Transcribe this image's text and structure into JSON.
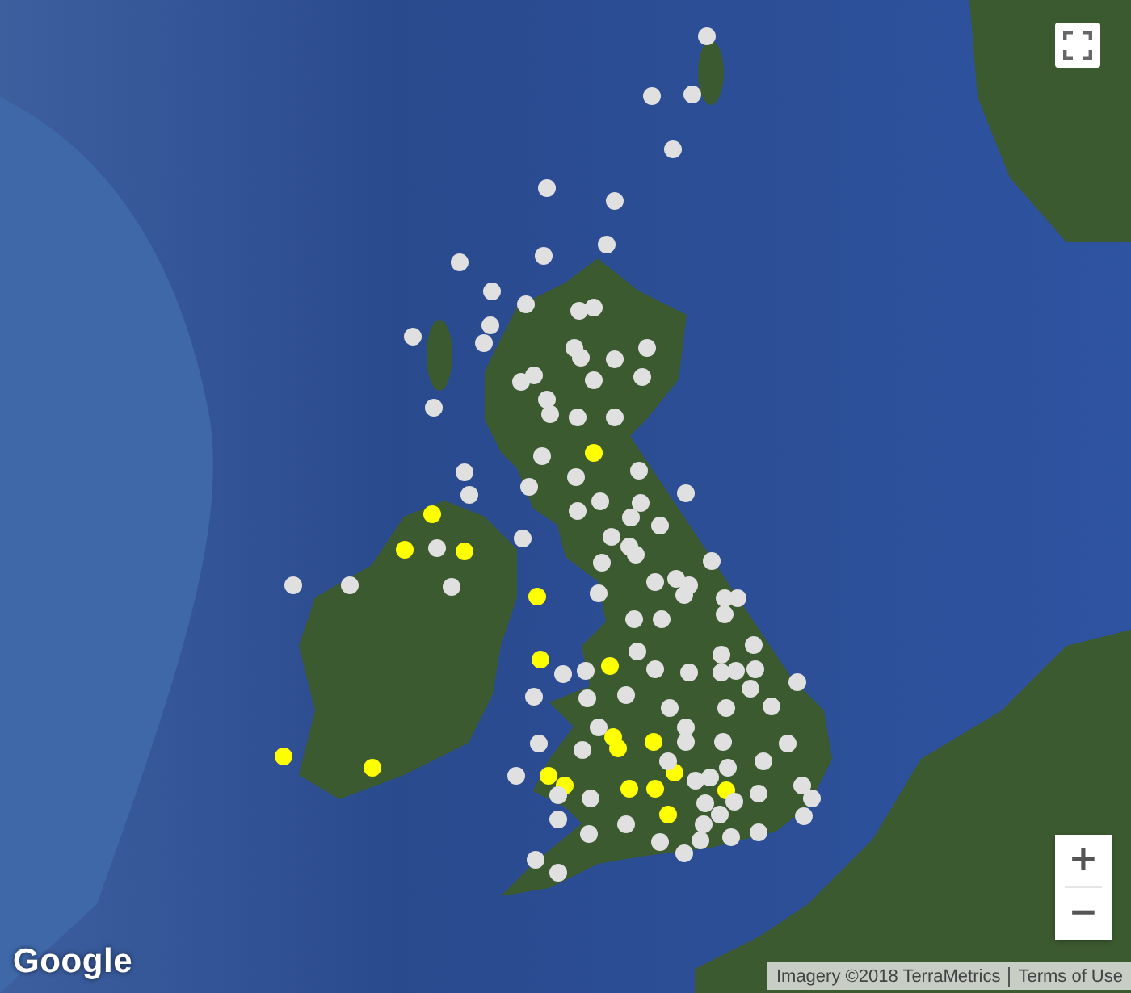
{
  "map": {
    "markers": [
      {
        "color": "#ffff00"
      },
      {
        "color": "#ffff00"
      },
      {
        "color": "#ffff00"
      },
      {
        "color": "#ffff00"
      },
      {
        "color": "#ffff00"
      },
      {
        "color": "#ffff00"
      },
      {
        "color": "#ffff00"
      },
      {
        "color": "#ffff00"
      },
      {
        "color": "#ffff00"
      },
      {
        "color": "#ffff00"
      },
      {
        "color": "#ffff00"
      },
      {
        "color": "#ffff00"
      },
      {
        "color": "#ffff00"
      },
      {
        "color": "#ffff00"
      },
      {
        "color": "#ffff00"
      },
      {
        "color": "#ffff00"
      },
      {
        "color": "#ffff00"
      },
      {
        "color": "#ffff00"
      },
      {
        "color": "#ffff00"
      },
      {
        "color": "#e0e0e0"
      },
      {
        "color": "#e0e0e0"
      },
      {
        "color": "#e0e0e0"
      },
      {
        "color": "#e0e0e0"
      },
      {
        "color": "#e0e0e0"
      },
      {
        "color": "#e0e0e0"
      },
      {
        "color": "#e0e0e0"
      },
      {
        "color": "#e0e0e0"
      },
      {
        "color": "#e0e0e0"
      },
      {
        "color": "#e0e0e0"
      },
      {
        "color": "#e0e0e0"
      },
      {
        "color": "#e0e0e0"
      },
      {
        "color": "#e0e0e0"
      },
      {
        "color": "#e0e0e0"
      },
      {
        "color": "#e0e0e0"
      },
      {
        "color": "#e0e0e0"
      },
      {
        "color": "#e0e0e0"
      },
      {
        "color": "#e0e0e0"
      },
      {
        "color": "#e0e0e0"
      },
      {
        "color": "#e0e0e0"
      },
      {
        "color": "#e0e0e0"
      },
      {
        "color": "#e0e0e0"
      },
      {
        "color": "#e0e0e0"
      },
      {
        "color": "#e0e0e0"
      },
      {
        "color": "#e0e0e0"
      },
      {
        "color": "#e0e0e0"
      },
      {
        "color": "#e0e0e0"
      },
      {
        "color": "#e0e0e0"
      },
      {
        "color": "#e0e0e0"
      },
      {
        "color": "#e0e0e0"
      },
      {
        "color": "#e0e0e0"
      },
      {
        "color": "#e0e0e0"
      },
      {
        "color": "#e0e0e0"
      },
      {
        "color": "#e0e0e0"
      },
      {
        "color": "#e0e0e0"
      },
      {
        "color": "#e0e0e0"
      },
      {
        "color": "#e0e0e0"
      },
      {
        "color": "#e0e0e0"
      },
      {
        "color": "#e0e0e0"
      },
      {
        "color": "#e0e0e0"
      },
      {
        "color": "#e0e0e0"
      },
      {
        "color": "#e0e0e0"
      },
      {
        "color": "#e0e0e0"
      },
      {
        "color": "#e0e0e0"
      },
      {
        "color": "#e0e0e0"
      },
      {
        "color": "#e0e0e0"
      },
      {
        "color": "#e0e0e0"
      },
      {
        "color": "#e0e0e0"
      },
      {
        "color": "#e0e0e0"
      },
      {
        "color": "#e0e0e0"
      },
      {
        "color": "#e0e0e0"
      },
      {
        "color": "#e0e0e0"
      },
      {
        "color": "#e0e0e0"
      },
      {
        "color": "#e0e0e0"
      },
      {
        "color": "#e0e0e0"
      },
      {
        "color": "#e0e0e0"
      },
      {
        "color": "#e0e0e0"
      },
      {
        "color": "#e0e0e0"
      },
      {
        "color": "#e0e0e0"
      },
      {
        "color": "#e0e0e0"
      },
      {
        "color": "#e0e0e0"
      },
      {
        "color": "#e0e0e0"
      },
      {
        "color": "#e0e0e0"
      },
      {
        "color": "#e0e0e0"
      },
      {
        "color": "#e0e0e0"
      },
      {
        "color": "#e0e0e0"
      },
      {
        "color": "#e0e0e0"
      },
      {
        "color": "#e0e0e0"
      },
      {
        "color": "#e0e0e0"
      },
      {
        "color": "#e0e0e0"
      },
      {
        "color": "#e0e0e0"
      },
      {
        "color": "#e0e0e0"
      },
      {
        "color": "#e0e0e0"
      },
      {
        "color": "#e0e0e0"
      },
      {
        "color": "#e0e0e0"
      },
      {
        "color": "#e0e0e0"
      },
      {
        "color": "#e0e0e0"
      },
      {
        "color": "#e0e0e0"
      },
      {
        "color": "#e0e0e0"
      },
      {
        "color": "#e0e0e0"
      },
      {
        "color": "#e0e0e0"
      },
      {
        "color": "#e0e0e0"
      },
      {
        "color": "#e0e0e0"
      },
      {
        "color": "#e0e0e0"
      },
      {
        "color": "#e0e0e0"
      },
      {
        "color": "#e0e0e0"
      },
      {
        "color": "#e0e0e0"
      },
      {
        "color": "#e0e0e0"
      },
      {
        "color": "#e0e0e0"
      },
      {
        "color": "#e0e0e0"
      },
      {
        "color": "#e0e0e0"
      },
      {
        "color": "#e0e0e0"
      },
      {
        "color": "#e0e0e0"
      },
      {
        "color": "#e0e0e0"
      },
      {
        "color": "#e0e0e0"
      },
      {
        "color": "#e0e0e0"
      },
      {
        "color": "#e0e0e0"
      },
      {
        "color": "#e0e0e0"
      },
      {
        "color": "#e0e0e0"
      },
      {
        "color": "#e0e0e0"
      },
      {
        "color": "#e0e0e0"
      },
      {
        "color": "#e0e0e0"
      },
      {
        "color": "#e0e0e0"
      },
      {
        "color": "#e0e0e0"
      },
      {
        "color": "#e0e0e0"
      },
      {
        "color": "#e0e0e0"
      },
      {
        "color": "#e0e0e0"
      },
      {
        "color": "#e0e0e0"
      },
      {
        "color": "#e0e0e0"
      },
      {
        "color": "#e0e0e0"
      },
      {
        "color": "#e0e0e0"
      },
      {
        "color": "#e0e0e0"
      }
    ]
  },
  "zoom_controls": {
    "zoom_in": "+",
    "zoom_out": "−"
  },
  "logo": "Google",
  "attribution": {
    "imagery": "Imagery ©2018 TerraMetrics",
    "terms_link": "Terms of Use"
  }
}
